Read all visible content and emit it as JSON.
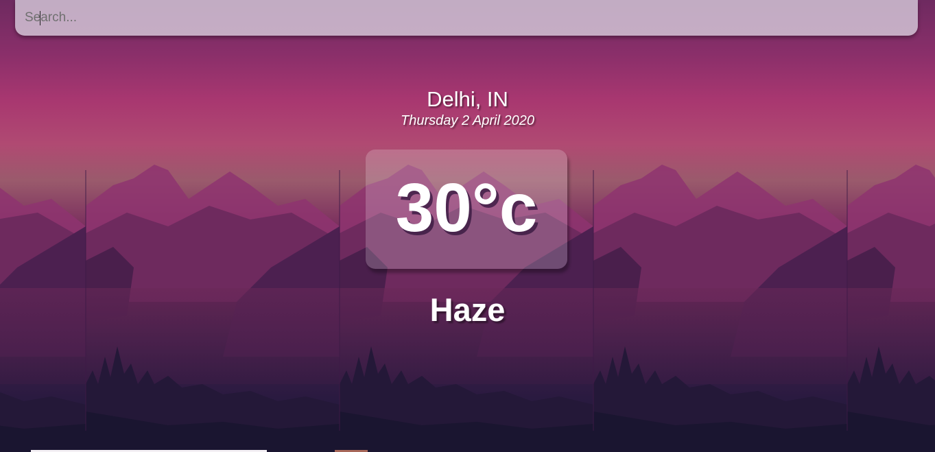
{
  "search": {
    "placeholder": "Search..."
  },
  "location": {
    "name": "Delhi, IN",
    "date": "Thursday 2 April 2020"
  },
  "weather": {
    "temperature": "30°c",
    "condition": "Haze"
  },
  "colors": {
    "sky_top": "#6e2a60",
    "sky_glow": "#b04a72",
    "ground": "#1a1636",
    "search_bg": "#d7cddc",
    "text": "#ffffff"
  }
}
